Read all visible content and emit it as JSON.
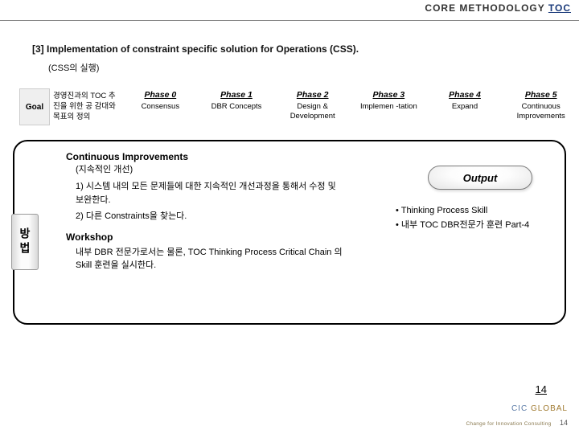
{
  "header": {
    "left": "CORE METHODOLOGY",
    "right": "TOC"
  },
  "section": {
    "num": "[3]",
    "title": "Implementation of constraint specific solution for Operations (CSS).",
    "sub": "(CSS의 실행)"
  },
  "goal": {
    "label": "Goal",
    "text": "경영진과의 TOC 추진을 위한 공 감대와 목표의 정의"
  },
  "phases": [
    {
      "head": "Phase 0",
      "body": "Consensus"
    },
    {
      "head": "Phase 1",
      "body": "DBR Concepts"
    },
    {
      "head": "Phase 2",
      "body": "Design & Development"
    },
    {
      "head": "Phase 3",
      "body": "Implemen -tation"
    },
    {
      "head": "Phase 4",
      "body": "Expand"
    },
    {
      "head": "Phase 5",
      "body": "Continuous Improvements"
    }
  ],
  "method_tab": "방법",
  "ci": {
    "title": "Continuous Improvements",
    "sub": "(지속적인 개선)",
    "items": [
      "1) 시스템 내의 모든 문제들에 대한 지속적인 개선과정을 통해서 수정 및 보완한다.",
      "2) 다른 Constraints을 찾는다."
    ]
  },
  "workshop": {
    "title": "Workshop",
    "body": "내부 DBR 전문가로서는 물론, TOC Thinking Process Critical Chain 의 Skill 훈련을 실시한다."
  },
  "output": {
    "badge": "Output",
    "items": [
      "Thinking Process Skill",
      "내부 TOC DBR전문가 훈련 Part-4"
    ]
  },
  "footer": {
    "page_big": "14",
    "logo1": "CIC",
    "logo2": "GLOBAL",
    "logo_sub": "Change for Innovation Consulting",
    "page_small": "14"
  }
}
